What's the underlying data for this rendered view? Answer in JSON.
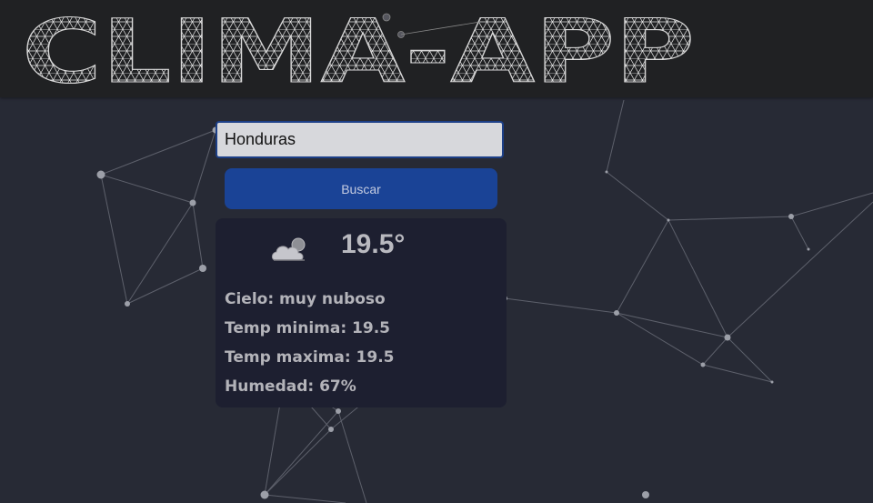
{
  "header": {
    "logo_text": "CLIMA-APP"
  },
  "search": {
    "value": "Honduras",
    "button_label": "Buscar"
  },
  "weather": {
    "icon": "partly-cloudy-icon",
    "temperature": "19.5°",
    "sky": "Cielo: muy nuboso",
    "temp_min": "Temp minima: 19.5",
    "temp_max": "Temp maxima: 19.5",
    "humidity": "Humedad: 67%"
  },
  "colors": {
    "background": "#272a35",
    "header": "#202123",
    "button": "#1a4396",
    "card": "#1d1f30"
  }
}
